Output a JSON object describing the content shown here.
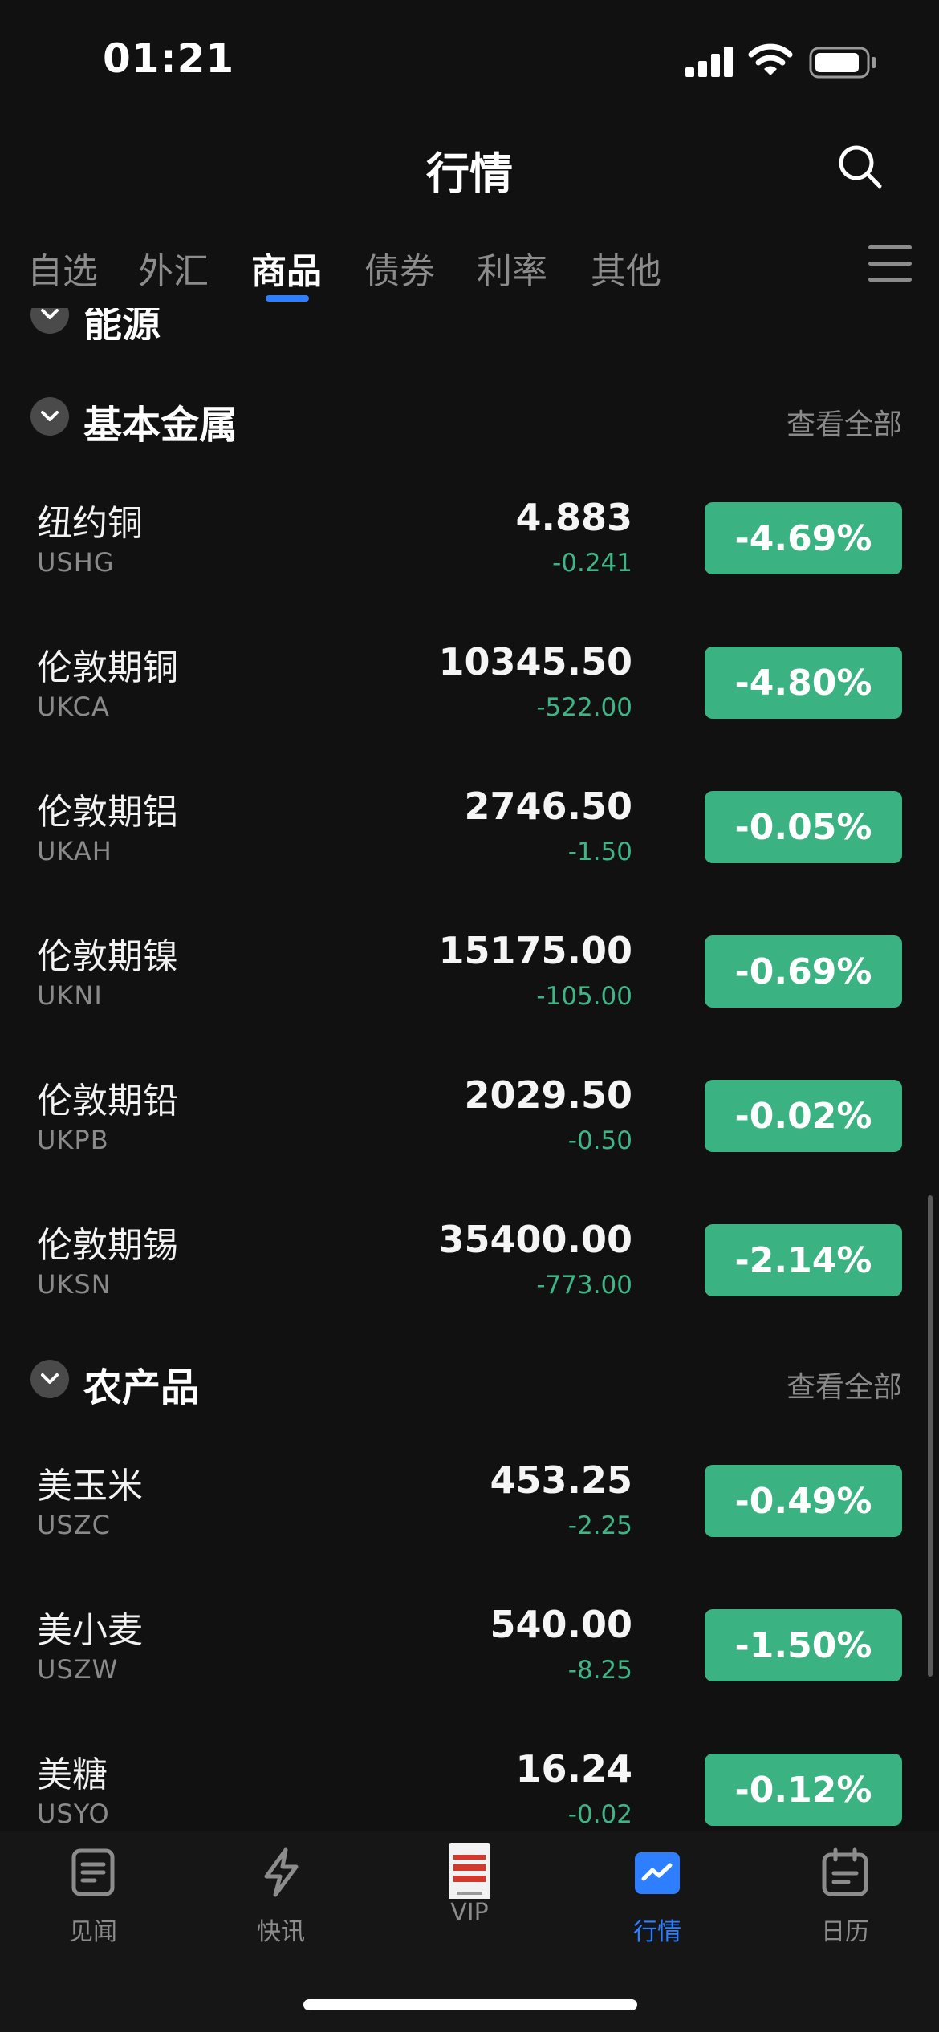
{
  "status_bar": {
    "time": "01:21"
  },
  "header": {
    "title": "行情"
  },
  "tabs": [
    {
      "label": "自选",
      "active": false
    },
    {
      "label": "外汇",
      "active": false
    },
    {
      "label": "商品",
      "active": true
    },
    {
      "label": "债券",
      "active": false
    },
    {
      "label": "利率",
      "active": false
    },
    {
      "label": "其他",
      "active": false
    }
  ],
  "sections": {
    "energy": {
      "title": "能源"
    },
    "base_metals": {
      "title": "基本金属",
      "view_all": "查看全部",
      "items": [
        {
          "name": "纽约铜",
          "code": "USHG",
          "price": "4.883",
          "change": "-0.241",
          "percent": "-4.69%"
        },
        {
          "name": "伦敦期铜",
          "code": "UKCA",
          "price": "10345.50",
          "change": "-522.00",
          "percent": "-4.80%"
        },
        {
          "name": "伦敦期铝",
          "code": "UKAH",
          "price": "2746.50",
          "change": "-1.50",
          "percent": "-0.05%"
        },
        {
          "name": "伦敦期镍",
          "code": "UKNI",
          "price": "15175.00",
          "change": "-105.00",
          "percent": "-0.69%"
        },
        {
          "name": "伦敦期铅",
          "code": "UKPB",
          "price": "2029.50",
          "change": "-0.50",
          "percent": "-0.02%"
        },
        {
          "name": "伦敦期锡",
          "code": "UKSN",
          "price": "35400.00",
          "change": "-773.00",
          "percent": "-2.14%"
        }
      ]
    },
    "agriculture": {
      "title": "农产品",
      "view_all": "查看全部",
      "items": [
        {
          "name": "美玉米",
          "code": "USZC",
          "price": "453.25",
          "change": "-2.25",
          "percent": "-0.49%"
        },
        {
          "name": "美小麦",
          "code": "USZW",
          "price": "540.00",
          "change": "-8.25",
          "percent": "-1.50%"
        },
        {
          "name": "美糖",
          "code": "USYO",
          "price": "16.24",
          "change": "-0.02",
          "percent": "-0.12%"
        }
      ]
    }
  },
  "bottom_nav": [
    {
      "label": "见闻",
      "icon": "document-icon",
      "active": false
    },
    {
      "label": "快讯",
      "icon": "lightning-icon",
      "active": false
    },
    {
      "label": "VIP",
      "icon": "vip-book-icon",
      "active": false
    },
    {
      "label": "行情",
      "icon": "chart-icon",
      "active": true
    },
    {
      "label": "日历",
      "icon": "calendar-icon",
      "active": false
    }
  ],
  "colors": {
    "background": "#111111",
    "accent": "#2d7fff",
    "down_badge": "#3bb282",
    "down_text": "#3fb585",
    "muted_text": "#8a8a8a"
  }
}
